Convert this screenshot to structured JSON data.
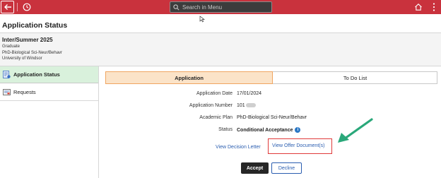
{
  "topbar": {
    "search_placeholder": "Search in Menu",
    "icons": [
      "back-arrow-icon",
      "history-icon",
      "search-icon",
      "home-icon",
      "more-vertical-icon"
    ],
    "color": "#c9323d"
  },
  "page": {
    "title": "Application Status"
  },
  "term": {
    "title": "Inter/Summer 2025",
    "career": "Graduate",
    "program": "PhD-Biological Sci-Neur/Behavr",
    "institution": "University of Windsor"
  },
  "sidebar": {
    "items": [
      {
        "label": "Application Status",
        "icon": "document-status-icon",
        "active": true
      },
      {
        "label": "Requests",
        "icon": "requests-icon",
        "active": false
      }
    ]
  },
  "tabs": [
    {
      "label": "Application",
      "active": true
    },
    {
      "label": "To Do List",
      "active": false
    }
  ],
  "details": {
    "application_date": {
      "label": "Application Date",
      "value": "17/01/2024"
    },
    "application_number": {
      "label": "Application Number",
      "value": "101"
    },
    "academic_plan": {
      "label": "Academic Plan",
      "value": "PhD-Biological Sci-Neur/Behavr"
    },
    "status": {
      "label": "Status",
      "value": "Conditional Acceptance"
    }
  },
  "links": {
    "decision_letter": "View Decision Letter",
    "offer_documents": "View Offer Document(s)"
  },
  "actions": {
    "accept": "Accept",
    "decline": "Decline"
  },
  "colors": {
    "accent_red": "#c9323d",
    "active_tab": "#fbe3c8",
    "active_sidebar": "#d9f1dc",
    "link": "#2a5db0",
    "highlight_box": "#e03a3a",
    "arrow": "#2aa87a"
  }
}
